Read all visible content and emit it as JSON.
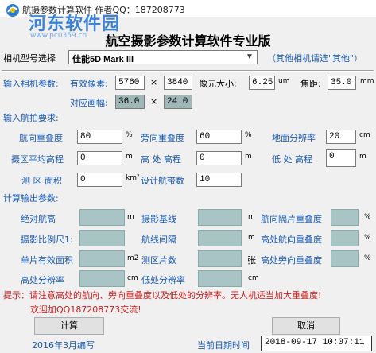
{
  "window": {
    "title": "航摄参数计算软件  作者QQ：187208773"
  },
  "watermark": {
    "line1": "河东软件园",
    "line2": "www.pc0359.cn"
  },
  "header": {
    "title": "航空摄影参数计算软件专业版"
  },
  "camera": {
    "label": "相机型号选择",
    "selected": "佳能5D Mark III",
    "hint": "（其他相机请选\"其他\"）"
  },
  "input_camera": {
    "section": "输入相机参数:",
    "pixels_label": "有效像素:",
    "width": "5760",
    "times": "×",
    "height": "3840",
    "mm_unit": "mm",
    "pixel_size_label": "像元大小:",
    "pixel_size": "6.25",
    "um_unit": "um",
    "focal_label": "焦距:",
    "focal": "35.0",
    "focal_unit": "mm",
    "diag_label": "对应画幅:",
    "frame_w": "36.0",
    "frame_h": "24.0"
  },
  "input_flight": {
    "section": "输入航拍要求:",
    "forward_label": "航向重叠度",
    "forward": "80",
    "forward_unit": "%",
    "side_label": "旁向重叠度",
    "side": "60",
    "side_unit": "%",
    "gsd_label": "地面分辨率",
    "gsd": "20",
    "gsd_unit": "cm",
    "avg_elev_label": "摄区平均高程",
    "avg_elev": "0",
    "avg_elev_unit": "m",
    "high_label": "高 处 高程",
    "high": "0",
    "high_unit": "m",
    "low_label": "低 处 高程",
    "low": "0",
    "low_unit": "m",
    "area_label": "测 区 面积",
    "area": "0",
    "area_unit": "km²",
    "strips_label": "设计航带数",
    "strips": "10"
  },
  "output": {
    "section": "计算输出参数:",
    "abs_height": "绝对航高",
    "abs_height_unit": "m",
    "baseline": "摄影基线",
    "baseline_unit": "m",
    "fwd_overlap": "航向隔片重叠度",
    "fwd_overlap_unit": "%",
    "scale": "摄影比例尺1:",
    "line_spacing": "航线间隔",
    "line_spacing_unit": "m",
    "high_fwd": "高处航向重叠度",
    "high_fwd_unit": "%",
    "area_single": "单片有效面积",
    "area_single_unit": "m2",
    "photo_count": "测区片数",
    "photo_count_unit": "张",
    "high_side": "高处旁向重叠度",
    "high_side_unit": "%",
    "high_res": "高处分辨率",
    "high_res_unit": "cm",
    "low_res": "低处分辨率",
    "low_res_unit": "cm"
  },
  "tips": {
    "line1": "提示：请注意高处的航向、旁向重叠度以及低处的分辨率。无人机适当加大重叠度!",
    "line2": "欢迎加QQ187208773交流!"
  },
  "buttons": {
    "calc": "计算",
    "cancel": "取消"
  },
  "footer": {
    "date_written": "2016年3月编写",
    "current_label": "当前日期时间",
    "datetime": "2018-09-17  10:07:11"
  }
}
